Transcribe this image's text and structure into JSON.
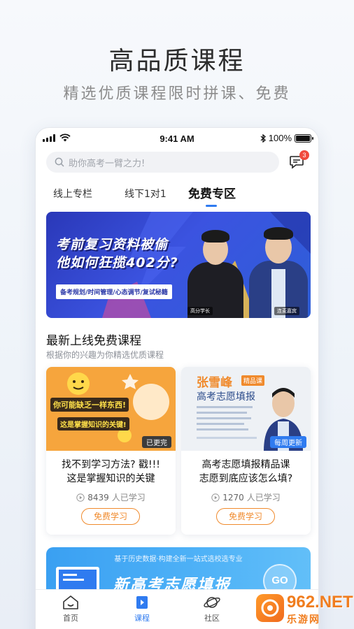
{
  "promo_header": {
    "title": "高品质课程",
    "subtitle": "精选优质课程限时拼课、免费"
  },
  "status_bar": {
    "time": "9:41 AM",
    "battery": "100%"
  },
  "search": {
    "placeholder": "助你高考一臂之力!"
  },
  "messages": {
    "badge_count": "3"
  },
  "tabs": [
    {
      "label": "线上专栏",
      "active": false
    },
    {
      "label": "线下1对1",
      "active": false
    },
    {
      "label": "免费专区",
      "active": true
    }
  ],
  "banner": {
    "line1": "考前复习资料被偷",
    "line2": "他如何狂揽402分?",
    "tags": "备考规划/时间管理/心态调节/复试秘籍",
    "person_left_caption": "高分学长",
    "person_right_caption": "连麦嘉宾"
  },
  "section": {
    "title": "最新上线免费课程",
    "subtitle": "根据你的兴趣为你精选优质课程"
  },
  "cards": [
    {
      "image_text1": "你可能缺乏一样东西!",
      "image_text2": "这是掌握知识的关键!",
      "corner_label": "已更完",
      "title": "找不到学习方法? 戳!!!\n这是掌握知识的关键",
      "title_line1": "找不到学习方法? 戳!!!",
      "title_line2": "这是掌握知识的关键",
      "count": "8439",
      "count_suffix": "人已学习",
      "button": "免费学习"
    },
    {
      "image_name": "张雪峰",
      "image_badge": "精品课",
      "image_title": "高考志愿填报",
      "corner_label": "每周更新",
      "title_line1": "高考志愿填报精品课",
      "title_line2": "志愿到底应该怎么填?",
      "count": "1270",
      "count_suffix": "人已学习",
      "button": "免费学习"
    }
  ],
  "promo_banner": {
    "top_text": "基于历史数据·构建全新一站式选校选专业",
    "title": "新高考志愿填报",
    "go_label": "GO"
  },
  "tabbar": [
    {
      "label": "首页",
      "icon": "home-icon",
      "active": false
    },
    {
      "label": "课程",
      "icon": "course-icon",
      "active": true
    },
    {
      "label": "社区",
      "icon": "planet-icon",
      "active": false
    }
  ],
  "watermark": {
    "number": "962.NET",
    "text": "乐游网"
  },
  "colors": {
    "accent": "#2f7bf0",
    "orange": "#f08a2c",
    "badge": "#f04a3c"
  }
}
